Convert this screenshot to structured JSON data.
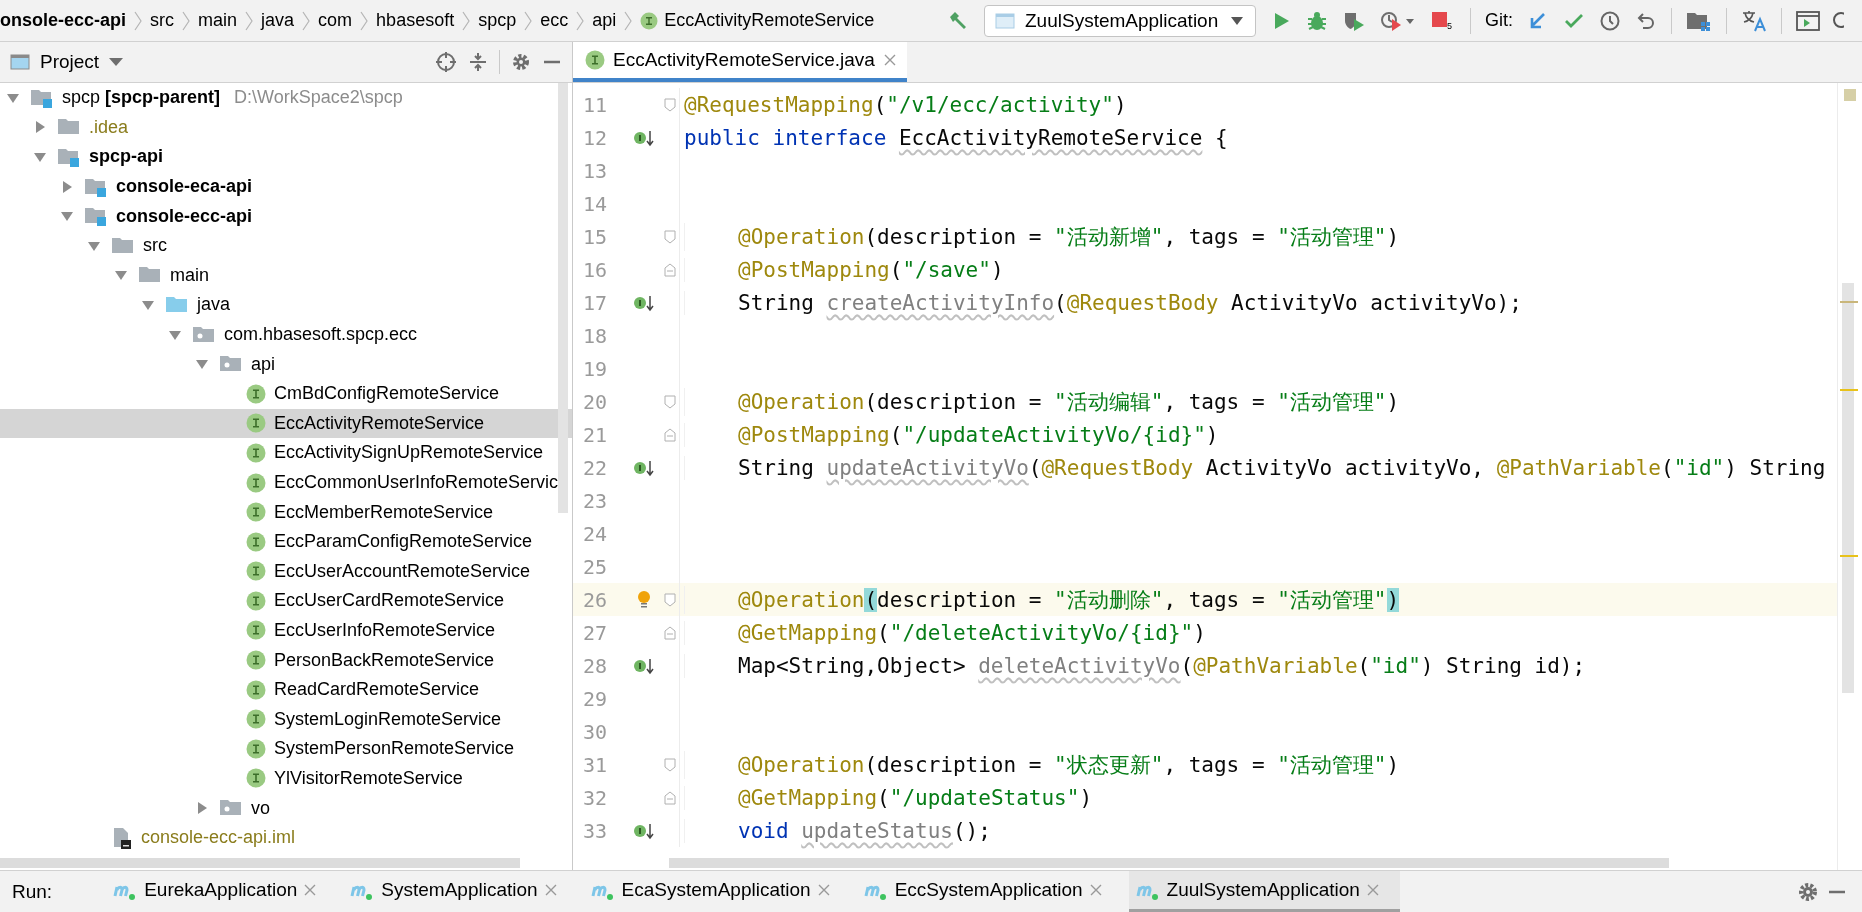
{
  "breadcrumbs": [
    {
      "label": "onsole-ecc-api",
      "bold": true
    },
    {
      "label": "src"
    },
    {
      "label": "main"
    },
    {
      "label": "java"
    },
    {
      "label": "com"
    },
    {
      "label": "hbasesoft"
    },
    {
      "label": "spcp"
    },
    {
      "label": "ecc"
    },
    {
      "label": "api"
    },
    {
      "label": "EccActivityRemoteService",
      "kind": "interface"
    }
  ],
  "toolbar": {
    "run_config": "ZuulSystemApplication",
    "stop_badge": "5",
    "git_label": "Git:"
  },
  "project_panel": {
    "title": "Project",
    "tree": [
      {
        "label": "spcp **[spcp-parent]**",
        "location": "D:\\WorkSpace2\\spcp",
        "kind": "module",
        "expanded": true,
        "selected": false,
        "children": [
          {
            "label": ".idea",
            "kind": "folder",
            "expanded": false,
            "ignored": true,
            "selected": false
          },
          {
            "label": "spcp-api",
            "kind": "module",
            "bold": true,
            "expanded": true,
            "selected": false,
            "children": [
              {
                "label": "console-eca-api",
                "kind": "module",
                "bold": true,
                "expanded": false,
                "selected": false
              },
              {
                "label": "console-ecc-api",
                "kind": "module",
                "bold": true,
                "expanded": true,
                "selected": false,
                "children": [
                  {
                    "label": "src",
                    "kind": "folder",
                    "expanded": true,
                    "selected": false,
                    "children": [
                      {
                        "label": "main",
                        "kind": "folder",
                        "expanded": true,
                        "selected": false,
                        "children": [
                          {
                            "label": "java",
                            "kind": "source-folder",
                            "expanded": true,
                            "selected": false,
                            "children": [
                              {
                                "label": "com.hbasesoft.spcp.ecc",
                                "kind": "package",
                                "expanded": true,
                                "selected": false,
                                "children": [
                                  {
                                    "label": "api",
                                    "kind": "package",
                                    "expanded": true,
                                    "selected": false,
                                    "children": [
                                      {
                                        "label": "CmBdConfigRemoteService",
                                        "kind": "interface",
                                        "selected": false
                                      },
                                      {
                                        "label": "EccActivityRemoteService",
                                        "kind": "interface",
                                        "selected": true
                                      },
                                      {
                                        "label": "EccActivitySignUpRemoteService",
                                        "kind": "interface",
                                        "selected": false
                                      },
                                      {
                                        "label": "EccCommonUserInfoRemoteServic",
                                        "kind": "interface",
                                        "selected": false
                                      },
                                      {
                                        "label": "EccMemberRemoteService",
                                        "kind": "interface",
                                        "selected": false
                                      },
                                      {
                                        "label": "EccParamConfigRemoteService",
                                        "kind": "interface",
                                        "selected": false
                                      },
                                      {
                                        "label": "EccUserAccountRemoteService",
                                        "kind": "interface",
                                        "selected": false
                                      },
                                      {
                                        "label": "EccUserCardRemoteService",
                                        "kind": "interface",
                                        "selected": false
                                      },
                                      {
                                        "label": "EccUserInfoRemoteService",
                                        "kind": "interface",
                                        "selected": false
                                      },
                                      {
                                        "label": "PersonBackRemoteService",
                                        "kind": "interface",
                                        "selected": false
                                      },
                                      {
                                        "label": "ReadCardRemoteService",
                                        "kind": "interface",
                                        "selected": false
                                      },
                                      {
                                        "label": "SystemLoginRemoteService",
                                        "kind": "interface",
                                        "selected": false
                                      },
                                      {
                                        "label": "SystemPersonRemoteService",
                                        "kind": "interface",
                                        "selected": false
                                      },
                                      {
                                        "label": "YlVisitorRemoteService",
                                        "kind": "interface",
                                        "selected": false
                                      }
                                    ]
                                  },
                                  {
                                    "label": "vo",
                                    "kind": "package",
                                    "expanded": false,
                                    "selected": false
                                  }
                                ]
                              }
                            ]
                          }
                        ]
                      }
                    ]
                  },
                  {
                    "label": "console-ecc-api.iml",
                    "kind": "iml-file",
                    "ignored": true,
                    "selected": false
                  }
                ]
              }
            ]
          }
        ]
      }
    ]
  },
  "editor": {
    "tab": {
      "label": "EccActivityRemoteService.java",
      "selected": true
    },
    "lines": [
      {
        "number": "11",
        "fold_start": true,
        "tokens": [
          {
            "kind": "annotation",
            "text": "@RequestMapping"
          },
          {
            "kind": "plain",
            "text": "("
          },
          {
            "kind": "string",
            "text": "\"/v1/ecc/activity\""
          },
          {
            "kind": "plain",
            "text": ")"
          }
        ]
      },
      {
        "number": "12",
        "implemented_marker": true,
        "tokens": [
          {
            "kind": "keyword",
            "text": "public interface "
          },
          {
            "kind": "unused-class",
            "text": "EccActivityRemoteService"
          },
          {
            "kind": "plain",
            "text": " {"
          }
        ]
      },
      {
        "number": "13"
      },
      {
        "number": "14"
      },
      {
        "number": "15",
        "fold_start": true,
        "indented": true,
        "tokens": [
          {
            "kind": "annotation",
            "text": "@Operation"
          },
          {
            "kind": "plain",
            "text": "(description = "
          },
          {
            "kind": "string",
            "text": "\"活动新增\""
          },
          {
            "kind": "plain",
            "text": ", tags = "
          },
          {
            "kind": "string",
            "text": "\"活动管理\""
          },
          {
            "kind": "plain",
            "text": ")"
          }
        ]
      },
      {
        "number": "16",
        "fold_end": true,
        "indented": true,
        "tokens": [
          {
            "kind": "annotation",
            "text": "@PostMapping"
          },
          {
            "kind": "plain",
            "text": "("
          },
          {
            "kind": "string",
            "text": "\"/save\""
          },
          {
            "kind": "plain",
            "text": ")"
          }
        ]
      },
      {
        "number": "17",
        "implemented_marker": true,
        "indented": true,
        "tokens": [
          {
            "kind": "plain",
            "text": "String "
          },
          {
            "kind": "unused-method",
            "text": "createActivityInfo"
          },
          {
            "kind": "plain",
            "text": "("
          },
          {
            "kind": "annotation",
            "text": "@RequestBody"
          },
          {
            "kind": "plain",
            "text": " ActivityVo activityVo);"
          }
        ]
      },
      {
        "number": "18"
      },
      {
        "number": "19"
      },
      {
        "number": "20",
        "fold_start": true,
        "indented": true,
        "tokens": [
          {
            "kind": "annotation",
            "text": "@Operation"
          },
          {
            "kind": "plain",
            "text": "(description = "
          },
          {
            "kind": "string",
            "text": "\"活动编辑\""
          },
          {
            "kind": "plain",
            "text": ", tags = "
          },
          {
            "kind": "string",
            "text": "\"活动管理\""
          },
          {
            "kind": "plain",
            "text": ")"
          }
        ]
      },
      {
        "number": "21",
        "fold_end": true,
        "indented": true,
        "tokens": [
          {
            "kind": "annotation",
            "text": "@PostMapping"
          },
          {
            "kind": "plain",
            "text": "("
          },
          {
            "kind": "string",
            "text": "\"/updateActivityVo/{id}\""
          },
          {
            "kind": "plain",
            "text": ")"
          }
        ]
      },
      {
        "number": "22",
        "implemented_marker": true,
        "indented": true,
        "tokens": [
          {
            "kind": "plain",
            "text": "String "
          },
          {
            "kind": "unused-method",
            "text": "updateActivityVo"
          },
          {
            "kind": "plain",
            "text": "("
          },
          {
            "kind": "annotation",
            "text": "@RequestBody"
          },
          {
            "kind": "plain",
            "text": " ActivityVo activityVo, "
          },
          {
            "kind": "annotation",
            "text": "@PathVariable"
          },
          {
            "kind": "plain",
            "text": "("
          },
          {
            "kind": "string",
            "text": "\"id\""
          },
          {
            "kind": "plain",
            "text": ") String"
          }
        ]
      },
      {
        "number": "23"
      },
      {
        "number": "24"
      },
      {
        "number": "25"
      },
      {
        "number": "26",
        "intention_bulb": true,
        "fold_start": true,
        "current": true,
        "indented": true,
        "tokens": [
          {
            "kind": "annotation",
            "text": "@Operation"
          },
          {
            "kind": "brace-match",
            "text": "("
          },
          {
            "kind": "plain",
            "text": "description = "
          },
          {
            "kind": "string",
            "text": "\"活动删除\""
          },
          {
            "kind": "plain",
            "text": ", tags = "
          },
          {
            "kind": "string",
            "text": "\"活动管理\""
          },
          {
            "kind": "brace-match",
            "text": ")"
          }
        ]
      },
      {
        "number": "27",
        "fold_end": true,
        "indented": true,
        "tokens": [
          {
            "kind": "annotation",
            "text": "@GetMapping"
          },
          {
            "kind": "plain",
            "text": "("
          },
          {
            "kind": "string",
            "text": "\"/deleteActivityVo/{id}\""
          },
          {
            "kind": "plain",
            "text": ")"
          }
        ]
      },
      {
        "number": "28",
        "implemented_marker": true,
        "indented": true,
        "tokens": [
          {
            "kind": "plain",
            "text": "Map<String,Object> "
          },
          {
            "kind": "unused-method",
            "text": "deleteActivityVo"
          },
          {
            "kind": "plain",
            "text": "("
          },
          {
            "kind": "annotation",
            "text": "@PathVariable"
          },
          {
            "kind": "plain",
            "text": "("
          },
          {
            "kind": "string",
            "text": "\"id\""
          },
          {
            "kind": "plain",
            "text": ") String id);"
          }
        ]
      },
      {
        "number": "29"
      },
      {
        "number": "30"
      },
      {
        "number": "31",
        "fold_start": true,
        "indented": true,
        "tokens": [
          {
            "kind": "annotation",
            "text": "@Operation"
          },
          {
            "kind": "plain",
            "text": "(description = "
          },
          {
            "kind": "string",
            "text": "\"状态更新\""
          },
          {
            "kind": "plain",
            "text": ", tags = "
          },
          {
            "kind": "string",
            "text": "\"活动管理\""
          },
          {
            "kind": "plain",
            "text": ")"
          }
        ]
      },
      {
        "number": "32",
        "fold_end": true,
        "indented": true,
        "tokens": [
          {
            "kind": "annotation",
            "text": "@GetMapping"
          },
          {
            "kind": "plain",
            "text": "("
          },
          {
            "kind": "string",
            "text": "\"/updateStatus\""
          },
          {
            "kind": "plain",
            "text": ")"
          }
        ]
      },
      {
        "number": "33",
        "implemented_marker": true,
        "indented": true,
        "tokens": [
          {
            "kind": "keyword",
            "text": "void "
          },
          {
            "kind": "unused-method",
            "text": "updateStatus"
          },
          {
            "kind": "plain",
            "text": "();"
          }
        ]
      }
    ]
  },
  "run_bar": {
    "label": "Run:",
    "tabs": [
      {
        "label": "EurekaApplication",
        "selected": false
      },
      {
        "label": "SystemApplication",
        "selected": false
      },
      {
        "label": "EcaSystemApplication",
        "selected": false
      },
      {
        "label": "EccSystemApplication",
        "selected": false
      },
      {
        "label": "ZuulSystemApplication",
        "selected": true
      }
    ]
  }
}
